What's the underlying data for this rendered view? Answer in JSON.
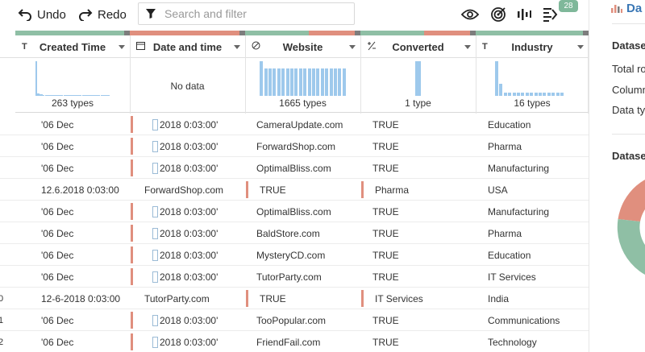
{
  "toolbar": {
    "undo_label": "Undo",
    "redo_label": "Redo",
    "search_placeholder": "Search and filter",
    "badge_count": "28"
  },
  "columns": [
    {
      "type_icon": "T",
      "name": "Created Time",
      "bar_colors": [
        "#8fbfa5",
        "#8fbfa5",
        "#7d7d7d"
      ]
    },
    {
      "type_icon": "calendar-icon",
      "name": "Date and time",
      "bar_colors": [
        "#e08f7e",
        "#e08f7e",
        "#7d7d7d"
      ]
    },
    {
      "type_icon": "url-icon",
      "name": "Website",
      "bar_colors": [
        "#8fbfa5",
        "#e08f7e",
        "#7d7d7d"
      ]
    },
    {
      "type_icon": "boolean-icon",
      "name": "Converted",
      "bar_colors": [
        "#8fbfa5",
        "#e08f7e",
        "#7d7d7d"
      ]
    },
    {
      "type_icon": "T",
      "name": "Industry",
      "bar_colors": [
        "#8fbfa5",
        "#8fbfa5",
        "#7d7d7d"
      ]
    }
  ],
  "histograms": [
    {
      "label": "263 types",
      "values": [
        1.0,
        0.08,
        0.05,
        0.04,
        0.03,
        0.03,
        0.03,
        0.02,
        0.02,
        0.02,
        0.02,
        0.02,
        0.02,
        0.02,
        0.02,
        0.02,
        0.02,
        0.02,
        0.02,
        0.02,
        0.02,
        0.02,
        0.02,
        0.02,
        0.02,
        0.02,
        0.02,
        0.02,
        0.02,
        0.02,
        0.02,
        0.02,
        0.02,
        0.02,
        0.02,
        0.02,
        0.02,
        0.02,
        0.02,
        0.02
      ]
    },
    {
      "label": "No data",
      "values": []
    },
    {
      "label": "1665 types",
      "values": [
        1.0,
        0.78,
        0.78,
        0.78,
        0.78,
        0.78,
        0.78,
        0.78,
        0.78,
        0.78,
        0.78,
        0.78,
        0.78,
        0.78,
        0.78,
        0.78,
        0.78,
        0.78,
        0.78,
        0.78
      ]
    },
    {
      "label": "1 type",
      "values": [
        1.0
      ]
    },
    {
      "label": "16 types",
      "values": [
        1.0,
        0.35,
        0.1,
        0.1,
        0.1,
        0.1,
        0.1,
        0.1,
        0.1,
        0.1,
        0.1,
        0.1,
        0.1,
        0.1,
        0.1,
        0.1
      ]
    }
  ],
  "rows": [
    {
      "num": "",
      "c1": "'06 Dec",
      "c2": "2018 0:03:00'",
      "c3": "CameraUpdate.com",
      "c4": "TRUE",
      "c5": "Education",
      "shifted": false
    },
    {
      "num": "",
      "c1": "'06 Dec",
      "c2": "2018 0:03:00'",
      "c3": "ForwardShop.com",
      "c4": "TRUE",
      "c5": "Pharma",
      "shifted": false
    },
    {
      "num": "",
      "c1": "'06 Dec",
      "c2": "2018 0:03:00'",
      "c3": "OptimalBliss.com",
      "c4": "TRUE",
      "c5": "Manufacturing",
      "shifted": false
    },
    {
      "num": "",
      "c1": "12.6.2018 0:03:00",
      "c2": "ForwardShop.com",
      "c3": "TRUE",
      "c4": "Pharma",
      "c5": "USA",
      "shifted": true
    },
    {
      "num": "",
      "c1": "'06 Dec",
      "c2": "2018 0:03:00'",
      "c3": "OptimalBliss.com",
      "c4": "TRUE",
      "c5": "Manufacturing",
      "shifted": false
    },
    {
      "num": "",
      "c1": "'06 Dec",
      "c2": "2018 0:03:00'",
      "c3": "BaldStore.com",
      "c4": "TRUE",
      "c5": "Pharma",
      "shifted": false
    },
    {
      "num": "",
      "c1": "'06 Dec",
      "c2": "2018 0:03:00'",
      "c3": "MysteryCD.com",
      "c4": "TRUE",
      "c5": "Education",
      "shifted": false
    },
    {
      "num": "",
      "c1": "'06 Dec",
      "c2": "2018 0:03:00'",
      "c3": "TutorParty.com",
      "c4": "TRUE",
      "c5": "IT Services",
      "shifted": false
    },
    {
      "num": "0",
      "c1": "12-6-2018 0:03:00",
      "c2": "TutorParty.com",
      "c3": "TRUE",
      "c4": "IT Services",
      "c5": "India",
      "shifted": true
    },
    {
      "num": "1",
      "c1": "'06 Dec",
      "c2": "2018 0:03:00'",
      "c3": "TooPopular.com",
      "c4": "TRUE",
      "c5": "Communications",
      "shifted": false
    },
    {
      "num": "2",
      "c1": "'06 Dec",
      "c2": "2018 0:03:00'",
      "c3": "FriendFail.com",
      "c4": "TRUE",
      "c5": "Technology",
      "shifted": false
    }
  ],
  "panel": {
    "title": "Da",
    "section1_title": "Dataset",
    "total_rows_label": "Total ro",
    "columns_label": "Column",
    "data_types_label": "Data typ",
    "section2_title": "Dataset",
    "donut_colors": [
      "#e08f7e",
      "#8fbfa5"
    ]
  },
  "colors": {
    "accent_red": "#e08f7e",
    "accent_green": "#8fbfa5",
    "bar_blue": "#9ec9ec",
    "badge_green": "#7fb89a",
    "title_blue": "#3a77b5"
  }
}
